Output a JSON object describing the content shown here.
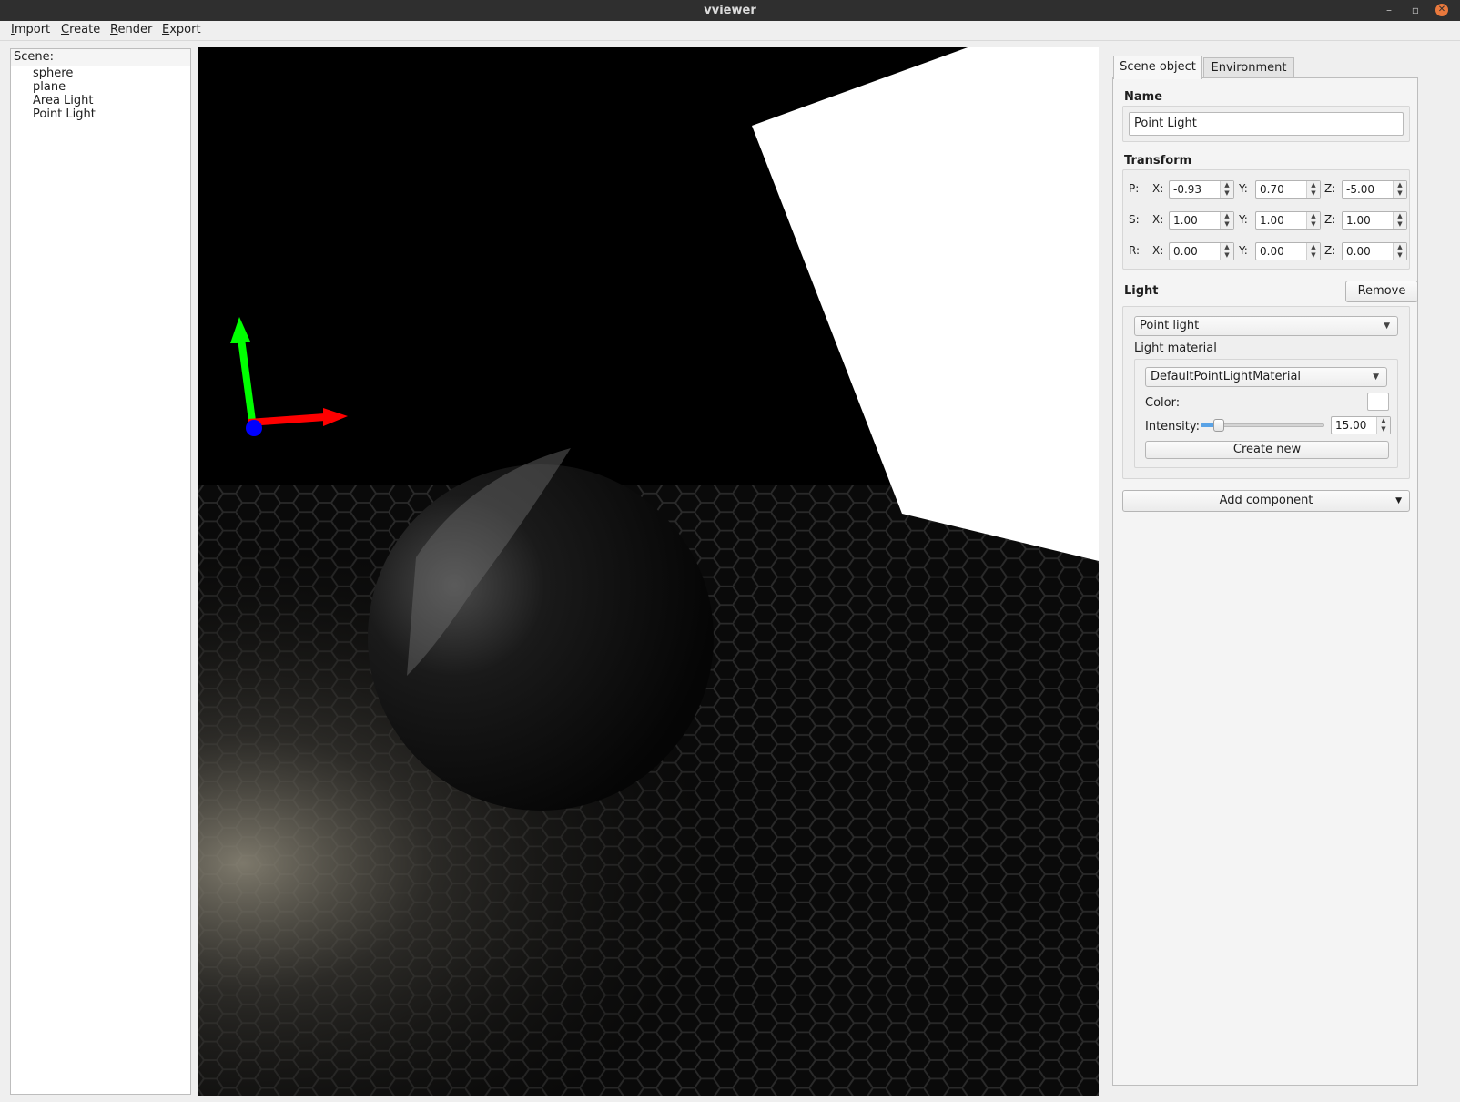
{
  "window": {
    "title": "vviewer"
  },
  "menu": [
    {
      "mnemonic": "I",
      "rest": "mport"
    },
    {
      "mnemonic": "C",
      "rest": "reate"
    },
    {
      "mnemonic": "R",
      "rest": "ender"
    },
    {
      "mnemonic": "E",
      "rest": "xport"
    }
  ],
  "scene": {
    "header": "Scene:",
    "items": [
      "sphere",
      "plane",
      "Area Light",
      "Point Light"
    ]
  },
  "tabs": [
    {
      "label": "Scene object",
      "active": true
    },
    {
      "label": "Environment",
      "active": false
    }
  ],
  "props": {
    "name_label": "Name",
    "name_value": "Point Light",
    "transform_label": "Transform",
    "transform": {
      "position": {
        "label": "P:",
        "x": "-0.93",
        "y": "0.70",
        "z": "-5.00"
      },
      "scale": {
        "label": "S:",
        "x": "1.00",
        "y": "1.00",
        "z": "1.00"
      },
      "rotation": {
        "label": "R:",
        "x": "0.00",
        "y": "0.00",
        "z": "0.00"
      },
      "axis_x": "X:",
      "axis_y": "Y:",
      "axis_z": "Z:"
    },
    "light_label": "Light",
    "remove_label": "Remove",
    "light_type": "Point light",
    "light_material_label": "Light material",
    "material": "DefaultPointLightMaterial",
    "color_label": "Color:",
    "color_value": "#ffffff",
    "intensity_label": "Intensity:",
    "intensity_value": "15.00",
    "intensity_slider_fraction": 0.15,
    "create_new_label": "Create new",
    "add_component_label": "Add component"
  },
  "gizmo": {
    "x_color": "#ff0000",
    "y_color": "#00ff00",
    "z_color": "#0000ff"
  }
}
